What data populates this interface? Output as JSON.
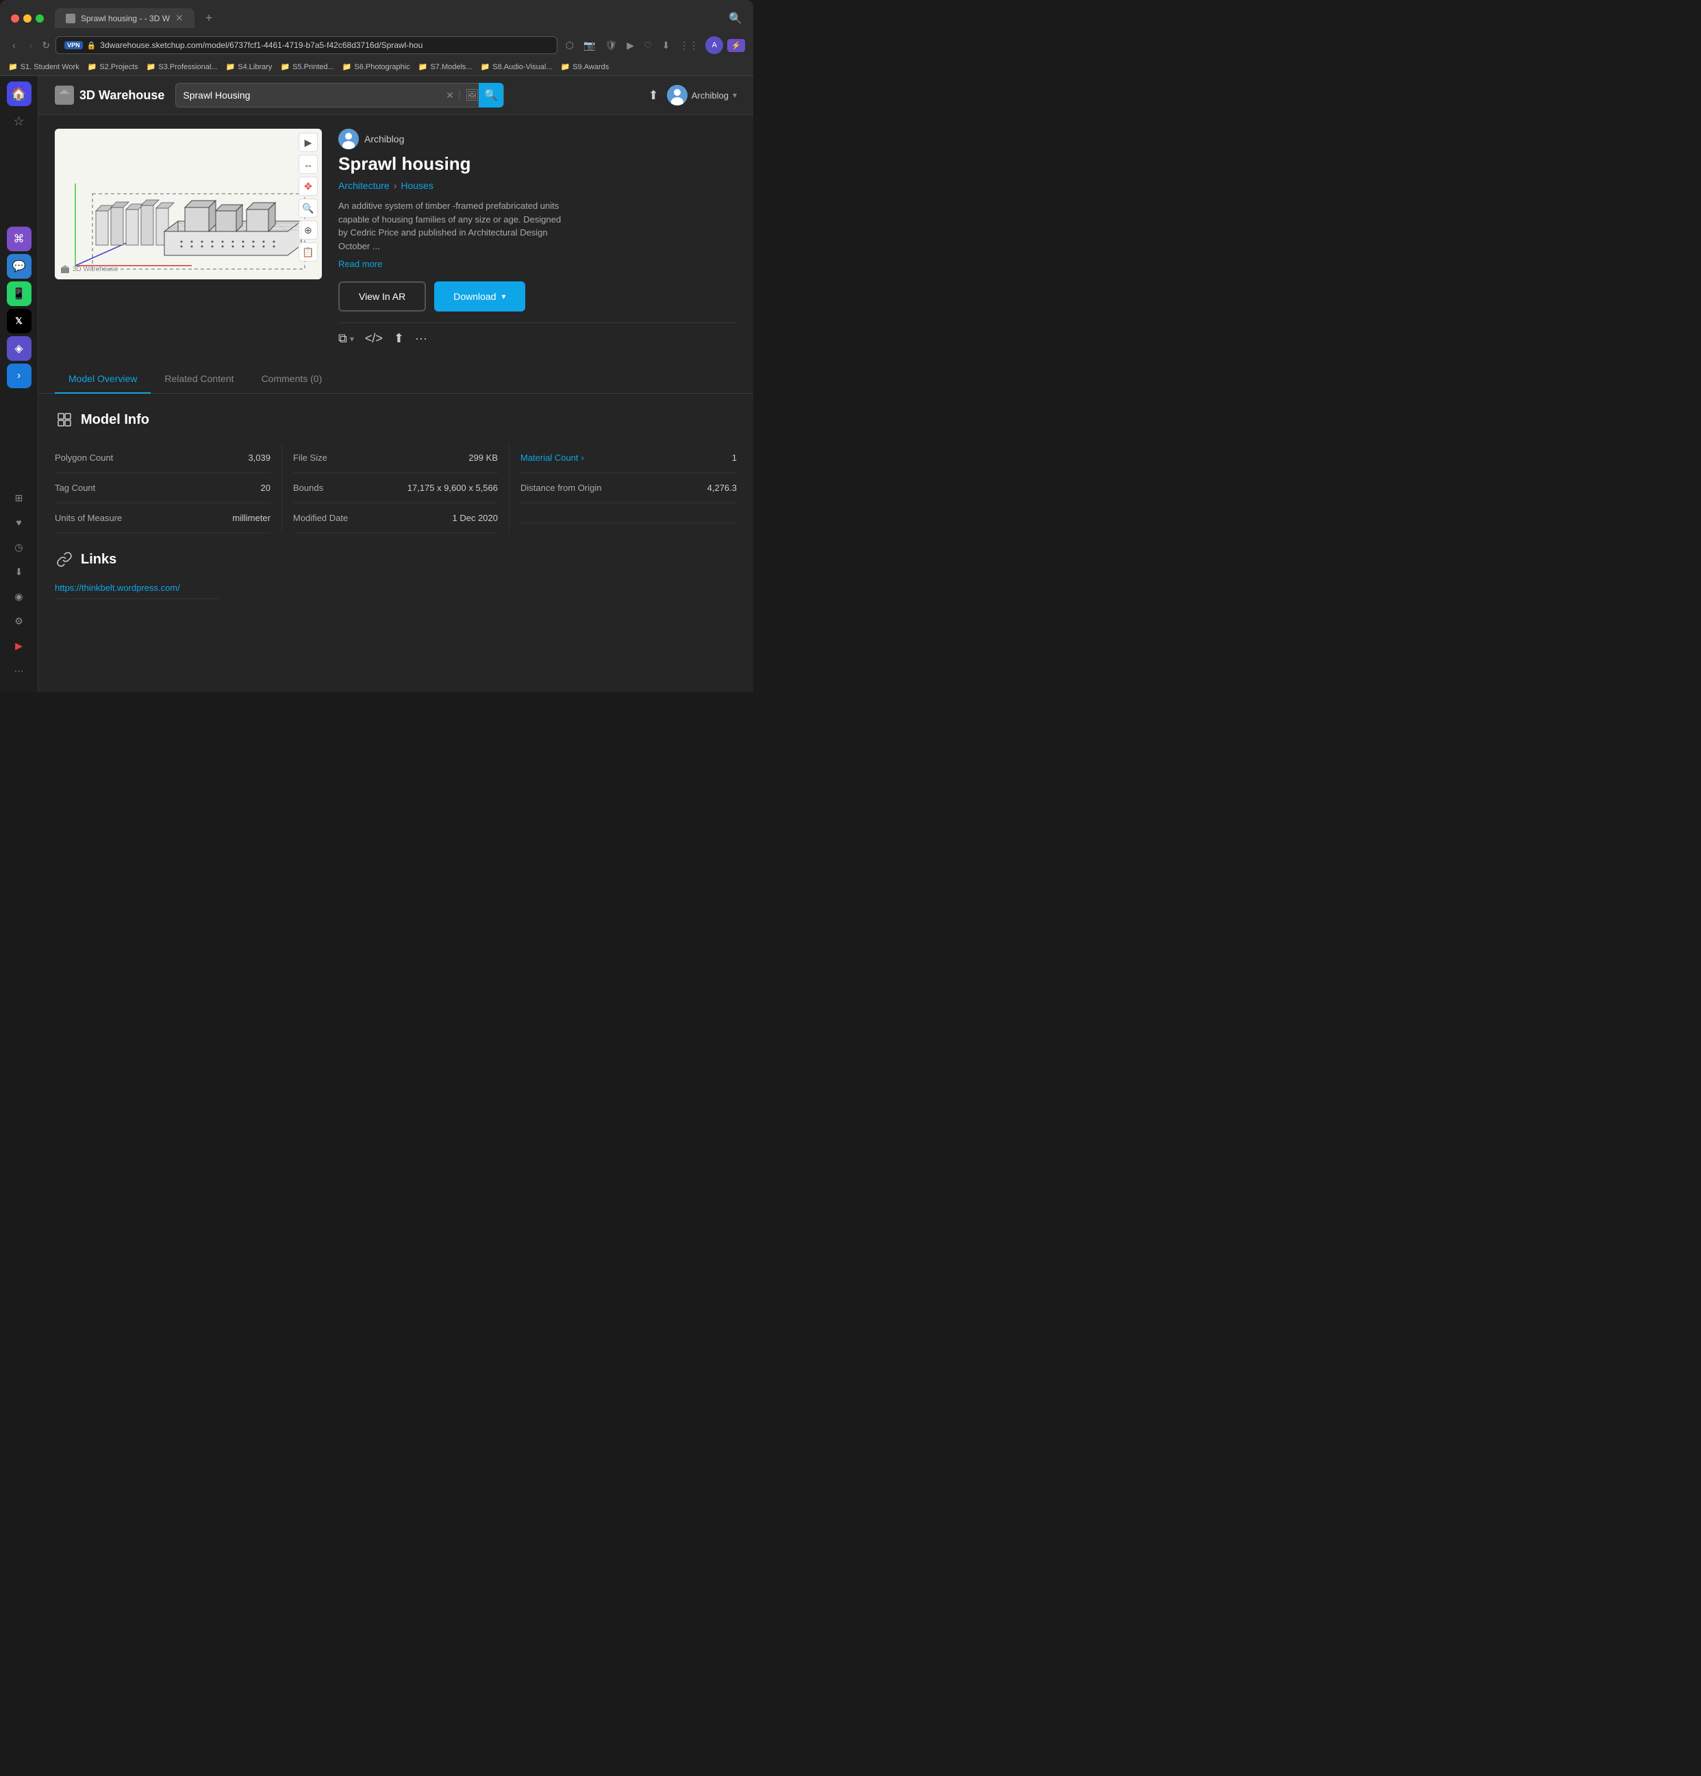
{
  "browser": {
    "tab_title": "Sprawl housing - - 3D W",
    "new_tab_label": "+",
    "address": "3dwarehouse.sketchup.com/model/6737fcf1-4461-4719-b7a5-f42c68d3716d/Sprawl-hou",
    "bookmarks": [
      {
        "label": "S1. Student Work",
        "icon": "📁"
      },
      {
        "label": "S2.Projects",
        "icon": "📁"
      },
      {
        "label": "S3.Professional...",
        "icon": "📁"
      },
      {
        "label": "S4.Library",
        "icon": "📁"
      },
      {
        "label": "S5.Printed...",
        "icon": "📁"
      },
      {
        "label": "S6.Photographic",
        "icon": "📁"
      },
      {
        "label": "S7.Models...",
        "icon": "📁"
      },
      {
        "label": "S8.Audio-Visual...",
        "icon": "📁"
      },
      {
        "label": "S9.Awards",
        "icon": "📁"
      }
    ]
  },
  "dock": {
    "home_icon": "🏠",
    "star_icon": "☆",
    "apps": [
      {
        "name": "arc-browser",
        "icon": "⌘",
        "color": "#7c4fc8"
      },
      {
        "name": "messages",
        "icon": "💬",
        "color": "#2d7dd2"
      },
      {
        "name": "whatsapp",
        "icon": "📱",
        "color": "#25d366"
      },
      {
        "name": "x-twitter",
        "icon": "𝕏",
        "color": "#000"
      },
      {
        "name": "figma",
        "icon": "◈",
        "color": "#5b4fc8"
      },
      {
        "name": "arrow",
        "icon": "›",
        "color": "#1a7adb"
      }
    ],
    "bottom_icons": [
      "⊞",
      "♥",
      "◷",
      "⬇",
      "◉",
      "⚙",
      "▶",
      "···"
    ]
  },
  "warehouse": {
    "logo_text": "3D Warehouse",
    "search_placeholder": "Sprawl Housing",
    "search_value": "Sprawl Housing",
    "profile_name": "Archiblog",
    "profile_chevron": "▾"
  },
  "model": {
    "author": "Archiblog",
    "title": "Sprawl housing",
    "breadcrumb": {
      "category": "Architecture",
      "subcategory": "Houses",
      "separator": "›"
    },
    "description": "An additive system of timber -framed prefabricated units capable of housing families of any size or age. Designed by Cedric Price and published in Architectural Design October ...",
    "read_more": "Read more",
    "view_ar_label": "View In AR",
    "download_label": "Download",
    "download_chevron": "▾",
    "watermark": "3D Warehouse"
  },
  "secondary_actions": {
    "copy_icon": "⧉",
    "copy_dropdown": "▾",
    "embed_icon": "</>",
    "share_icon": "⬆",
    "more_icon": "···"
  },
  "tabs": [
    {
      "label": "Model Overview",
      "active": true
    },
    {
      "label": "Related Content",
      "active": false
    },
    {
      "label": "Comments (0)",
      "active": false
    }
  ],
  "model_info": {
    "section_title": "Model Info",
    "fields": [
      [
        {
          "label": "Polygon Count",
          "value": "3,039"
        },
        {
          "label": "Tag Count",
          "value": "20"
        },
        {
          "label": "Units of Measure",
          "value": "millimeter"
        }
      ],
      [
        {
          "label": "File Size",
          "value": "299 KB"
        },
        {
          "label": "Bounds",
          "value": "17,175 x 9,600 x 5,566"
        },
        {
          "label": "Modified Date",
          "value": "1 Dec 2020"
        }
      ],
      [
        {
          "label": "Material Count",
          "value": "1",
          "is_link": true
        },
        {
          "label": "Distance from Origin",
          "value": "4,276.3"
        },
        {
          "label": "",
          "value": ""
        }
      ]
    ]
  },
  "links": {
    "section_title": "Links",
    "url": "https://thinkbelt.wordpress.com/"
  },
  "toolbar_items": [
    "▶",
    "↔",
    "👆",
    "🔍",
    "🔍",
    "📋"
  ]
}
